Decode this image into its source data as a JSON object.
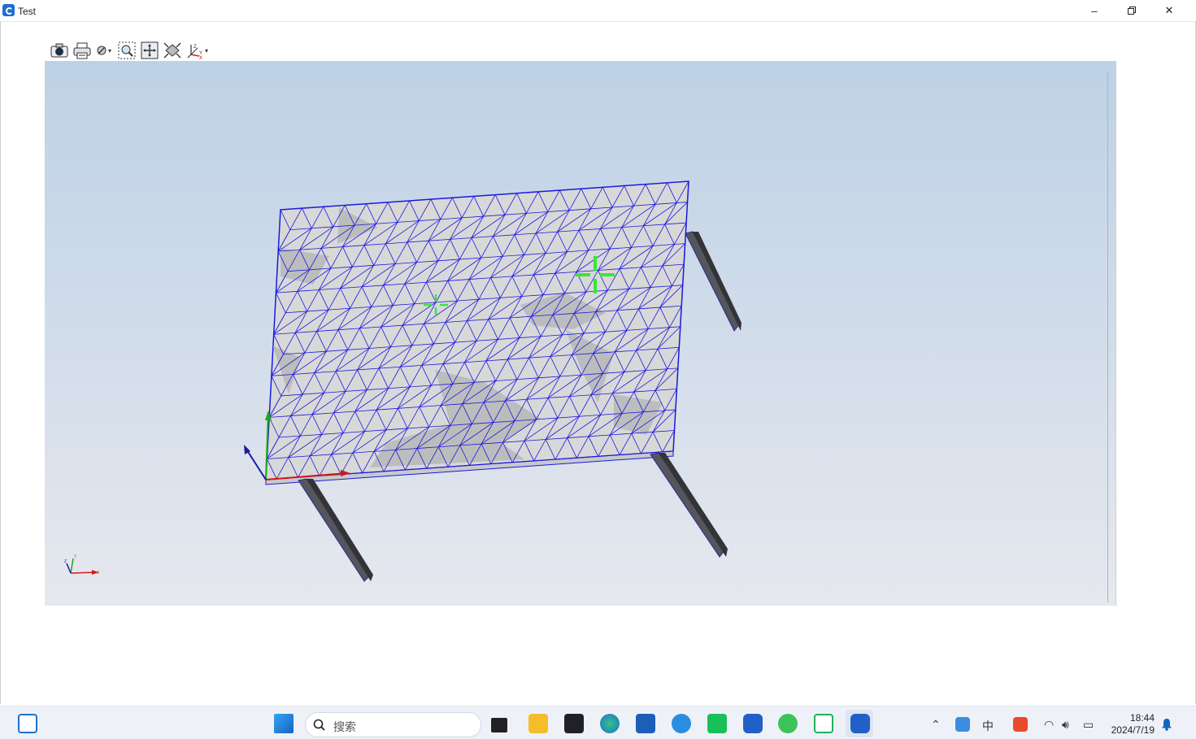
{
  "window": {
    "title": "Test"
  },
  "toolbar": {
    "tools": [
      {
        "name": "camera-icon"
      },
      {
        "name": "print-icon"
      },
      {
        "name": "display-mode-icon"
      },
      {
        "name": "zoom-window-icon"
      },
      {
        "name": "pan-icon"
      },
      {
        "name": "fit-all-icon"
      },
      {
        "name": "view-axis-icon"
      }
    ]
  },
  "viewport": {
    "background_top": "#bdd1e6",
    "background_bottom": "#e6e8ee",
    "mesh_color": "#1a1adf",
    "surface_color": "#d6d6d6",
    "axis": {
      "x_label": "X",
      "y_label": "Y",
      "z_label": "Z"
    }
  },
  "taskbar": {
    "search_placeholder": "搜索",
    "time": "18:44",
    "date": "2024/7/19",
    "ime_label": "中"
  }
}
